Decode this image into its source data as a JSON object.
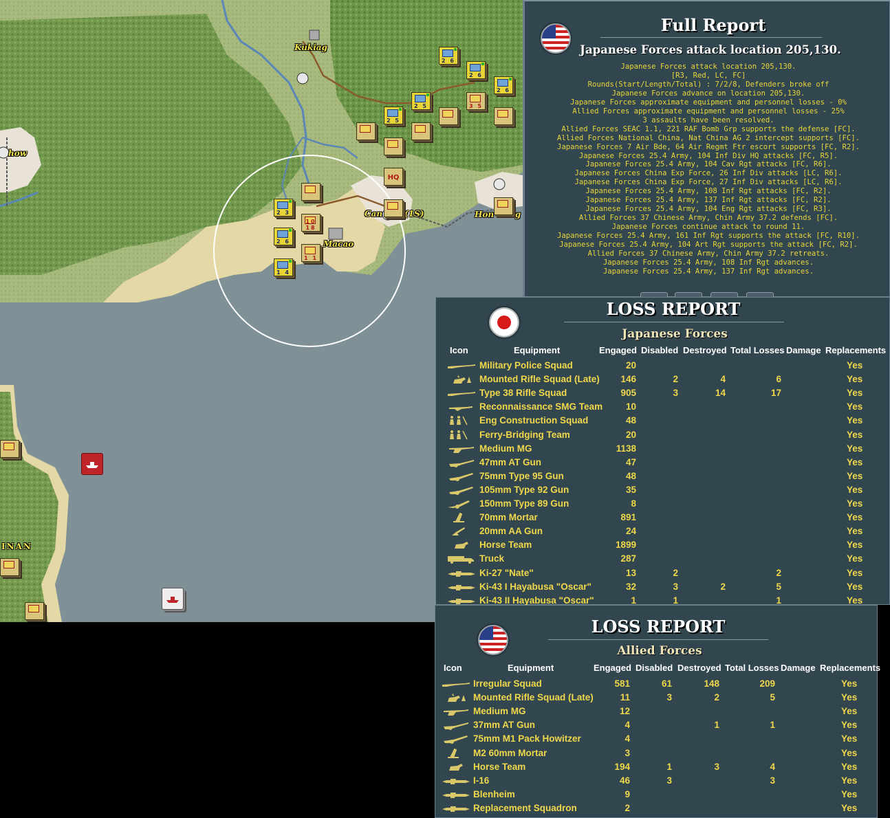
{
  "map": {
    "labels": {
      "kukiang": "Kukiag",
      "chow": "how",
      "canton": "Can",
      "canton_suffix": "(1S)",
      "macao": "Macao",
      "hongkong": "Hon",
      "hongkong_suffix": "ng",
      "hainan": "INAN"
    },
    "units": [
      {
        "kind": "blue",
        "nums": "2 6"
      },
      {
        "kind": "blue",
        "nums": "2 6"
      },
      {
        "kind": "blue",
        "nums": "2 6"
      },
      {
        "kind": "blue",
        "nums": "2 5"
      },
      {
        "kind": "blue",
        "nums": "2 5"
      },
      {
        "kind": "tan",
        "nums": "3 5"
      },
      {
        "kind": "blue",
        "nums": "2 3"
      },
      {
        "kind": "tan",
        "nums": "10 18"
      },
      {
        "kind": "blue",
        "nums": "2 6"
      },
      {
        "kind": "tan",
        "nums": "1 1"
      },
      {
        "kind": "blue",
        "nums": "1 4"
      },
      {
        "kind": "tan",
        "nums": "HQ"
      }
    ],
    "colors": {
      "land": "#9db272",
      "forest": "#5f8a3c",
      "sea": "#7f9197",
      "beach": "#e6d9a8",
      "river": "#5a86b8"
    }
  },
  "full_report": {
    "title": "Full Report",
    "subtitle": "Japanese Forces attack location 205,130.",
    "flag": "us-flag",
    "lines": [
      "Japanese Forces attack location 205,130.",
      "[R3, Red, LC, FC]",
      "Rounds(Start/Length/Total) : 7/2/8, Defenders broke off",
      "Japanese Forces advance on location 205,130.",
      "Japanese Forces approximate equipment and personnel losses - 0%",
      "Allied Forces approximate equipment and personnel losses - 25%",
      "3 assaults have been resolved.",
      "Allied Forces SEAC 1.1, 221 RAF Bomb Grp supports the defense [FC].",
      "Allied Forces National China, Nat China AG 2 intercept supports [FC].",
      "Japanese Forces 7 Air Bde, 64 Air Regmt Ftr escort supports [FC, R2].",
      "Japanese Forces 25.4 Army, 104 Inf Div HQ attacks [FC, R5].",
      "Japanese Forces 25.4 Army, 104 Cav Rgt attacks [FC, R6].",
      "Japanese Forces China Exp Force, 26 Inf Div attacks [LC, R6].",
      "Japanese Forces China Exp Force, 27 Inf Div attacks [LC, R6].",
      "Japanese Forces 25.4 Army, 108 Inf Rgt attacks [FC, R2].",
      "Japanese Forces 25.4 Army, 137 Inf Rgt attacks [FC, R2].",
      "Japanese Forces 25.4 Army, 104 Eng Rgt attacks [FC, R3].",
      "Allied Forces 37 Chinese Army, Chin Army 37.2 defends [FC].",
      "Japanese Forces continue attack to round 11.",
      "Japanese Forces 25.4 Army, 161 Inf Rgt supports the attack [FC, R10].",
      "Japanese Forces 25.4 Army, 104 Art Rgt supports the attack [FC, R2].",
      "Allied Forces 37 Chinese Army, Chin Army 37.2 retreats.",
      "Japanese Forces 25.4 Army, 108 Inf Rgt advances.",
      "Japanese Forces 25.4 Army, 137 Inf Rgt advances."
    ]
  },
  "loss_jp": {
    "title": "LOSS REPORT",
    "side": "Japanese Forces",
    "flag": "japan-flag",
    "headers": {
      "icon": "Icon",
      "equipment": "Equipment",
      "engaged": "Engaged",
      "disabled": "Disabled",
      "destroyed": "Destroyed",
      "total": "Total Losses",
      "damage": "Damage",
      "replacements": "Replacements"
    },
    "rows": [
      {
        "icon": "rifle-icon",
        "name": "Military Police Squad",
        "engaged": "20",
        "disabled": "",
        "destroyed": "",
        "total": "",
        "damage": "",
        "repl": "Yes"
      },
      {
        "icon": "horse-rider-icon",
        "name": "Mounted Rifle Squad (Late)",
        "engaged": "146",
        "disabled": "2",
        "destroyed": "4",
        "total": "6",
        "damage": "",
        "repl": "Yes"
      },
      {
        "icon": "rifle-icon",
        "name": "Type 38 Rifle Squad",
        "engaged": "905",
        "disabled": "3",
        "destroyed": "14",
        "total": "17",
        "damage": "",
        "repl": "Yes"
      },
      {
        "icon": "smg-icon",
        "name": "Reconnaissance SMG Team",
        "engaged": "10",
        "disabled": "",
        "destroyed": "",
        "total": "",
        "damage": "",
        "repl": "Yes"
      },
      {
        "icon": "engineers-icon",
        "name": "Eng Construction Squad",
        "engaged": "48",
        "disabled": "",
        "destroyed": "",
        "total": "",
        "damage": "",
        "repl": "Yes"
      },
      {
        "icon": "engineers-icon",
        "name": "Ferry-Bridging Team",
        "engaged": "20",
        "disabled": "",
        "destroyed": "",
        "total": "",
        "damage": "",
        "repl": "Yes"
      },
      {
        "icon": "machine-gun-icon",
        "name": "Medium MG",
        "engaged": "1138",
        "disabled": "",
        "destroyed": "",
        "total": "",
        "damage": "",
        "repl": "Yes"
      },
      {
        "icon": "at-gun-icon",
        "name": "47mm AT Gun",
        "engaged": "47",
        "disabled": "",
        "destroyed": "",
        "total": "",
        "damage": "",
        "repl": "Yes"
      },
      {
        "icon": "field-gun-icon",
        "name": "75mm Type 95 Gun",
        "engaged": "48",
        "disabled": "",
        "destroyed": "",
        "total": "",
        "damage": "",
        "repl": "Yes"
      },
      {
        "icon": "field-gun-icon",
        "name": "105mm Type 92 Gun",
        "engaged": "35",
        "disabled": "",
        "destroyed": "",
        "total": "",
        "damage": "",
        "repl": "Yes"
      },
      {
        "icon": "howitzer-icon",
        "name": "150mm Type 89 Gun",
        "engaged": "8",
        "disabled": "",
        "destroyed": "",
        "total": "",
        "damage": "",
        "repl": "Yes"
      },
      {
        "icon": "mortar-icon",
        "name": "70mm Mortar",
        "engaged": "891",
        "disabled": "",
        "destroyed": "",
        "total": "",
        "damage": "",
        "repl": "Yes"
      },
      {
        "icon": "aa-gun-icon",
        "name": "20mm AA Gun",
        "engaged": "24",
        "disabled": "",
        "destroyed": "",
        "total": "",
        "damage": "",
        "repl": "Yes"
      },
      {
        "icon": "horse-icon",
        "name": "Horse Team",
        "engaged": "1899",
        "disabled": "",
        "destroyed": "",
        "total": "",
        "damage": "",
        "repl": "Yes"
      },
      {
        "icon": "truck-icon",
        "name": "Truck",
        "engaged": "287",
        "disabled": "",
        "destroyed": "",
        "total": "",
        "damage": "",
        "repl": "Yes"
      },
      {
        "icon": "aircraft-icon",
        "name": "Ki-27 \"Nate\"",
        "engaged": "13",
        "disabled": "2",
        "destroyed": "",
        "total": "2",
        "damage": "",
        "repl": "Yes"
      },
      {
        "icon": "aircraft-icon",
        "name": "Ki-43 I Hayabusa \"Oscar\"",
        "engaged": "32",
        "disabled": "3",
        "destroyed": "2",
        "total": "5",
        "damage": "",
        "repl": "Yes"
      },
      {
        "icon": "aircraft-icon",
        "name": "Ki-43 II Hayabusa \"Oscar\"",
        "engaged": "1",
        "disabled": "1",
        "destroyed": "",
        "total": "1",
        "damage": "",
        "repl": "Yes"
      }
    ]
  },
  "loss_al": {
    "title": "LOSS REPORT",
    "side": "Allied Forces",
    "flag": "us-flag",
    "headers": {
      "icon": "Icon",
      "equipment": "Equipment",
      "engaged": "Engaged",
      "disabled": "Disabled",
      "destroyed": "Destroyed",
      "total": "Total Losses",
      "damage": "Damage",
      "replacements": "Replacements"
    },
    "rows": [
      {
        "icon": "rifle-icon",
        "name": "Irregular Squad",
        "engaged": "581",
        "disabled": "61",
        "destroyed": "148",
        "total": "209",
        "damage": "",
        "repl": "Yes"
      },
      {
        "icon": "horse-rider-icon",
        "name": "Mounted Rifle Squad (Late)",
        "engaged": "11",
        "disabled": "3",
        "destroyed": "2",
        "total": "5",
        "damage": "",
        "repl": "Yes"
      },
      {
        "icon": "machine-gun-icon",
        "name": "Medium MG",
        "engaged": "12",
        "disabled": "",
        "destroyed": "",
        "total": "",
        "damage": "",
        "repl": "Yes"
      },
      {
        "icon": "at-gun-icon",
        "name": "37mm AT Gun",
        "engaged": "4",
        "disabled": "",
        "destroyed": "1",
        "total": "1",
        "damage": "",
        "repl": "Yes"
      },
      {
        "icon": "field-gun-icon",
        "name": "75mm M1 Pack Howitzer",
        "engaged": "4",
        "disabled": "",
        "destroyed": "",
        "total": "",
        "damage": "",
        "repl": "Yes"
      },
      {
        "icon": "mortar-icon",
        "name": "M2 60mm Mortar",
        "engaged": "3",
        "disabled": "",
        "destroyed": "",
        "total": "",
        "damage": "",
        "repl": "Yes"
      },
      {
        "icon": "horse-icon",
        "name": "Horse Team",
        "engaged": "194",
        "disabled": "1",
        "destroyed": "3",
        "total": "4",
        "damage": "",
        "repl": "Yes"
      },
      {
        "icon": "aircraft-icon",
        "name": "I-16",
        "engaged": "46",
        "disabled": "3",
        "destroyed": "",
        "total": "3",
        "damage": "",
        "repl": "Yes"
      },
      {
        "icon": "aircraft-icon",
        "name": "Blenheim",
        "engaged": "9",
        "disabled": "",
        "destroyed": "",
        "total": "",
        "damage": "",
        "repl": "Yes"
      },
      {
        "icon": "aircraft-icon",
        "name": "Replacement Squadron",
        "engaged": "2",
        "disabled": "",
        "destroyed": "",
        "total": "",
        "damage": "",
        "repl": "Yes"
      }
    ]
  }
}
